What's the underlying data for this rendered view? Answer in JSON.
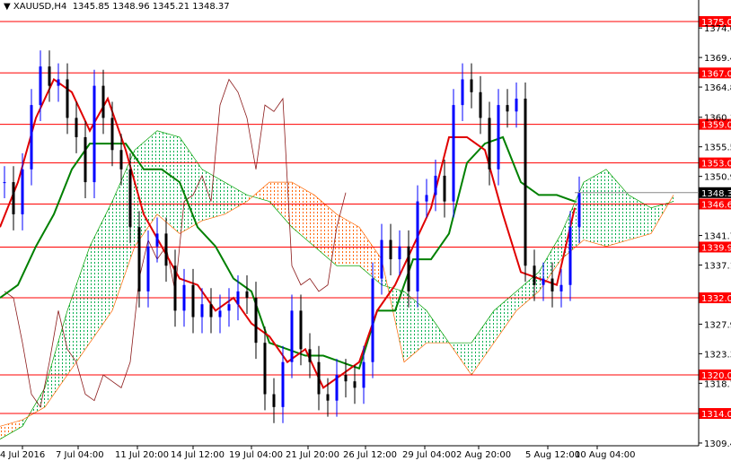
{
  "header": {
    "symbol": "XAUUSD,H4",
    "ohlc": "1345.85 1348.96 1345.21 1348.37"
  },
  "colors": {
    "level": "#ff0000",
    "tenkan": "#e00000",
    "kijun": "#008000",
    "chikou": "#8b1a1a",
    "bull": "#0000ff",
    "bear": "#000000",
    "cloud_up": "#00b050",
    "cloud_down": "#ff6600"
  },
  "chart_data": {
    "type": "line",
    "title": "XAUUSD,H4",
    "ylim": [
      1307,
      1378
    ],
    "y_ticks": [
      "1374.00",
      "1369.40",
      "1364.80",
      "1360.10",
      "1355.50",
      "1350.90",
      "1341.70",
      "1337.10",
      "1327.90",
      "1323.30",
      "1318.70",
      "1309.40"
    ],
    "x_ticks": [
      "4 Jul 2016",
      "7 Jul 04:00",
      "11 Jul 20:00",
      "14 Jul 12:00",
      "19 Jul 04:00",
      "21 Jul 20:00",
      "26 Jul 12:00",
      "29 Jul 04:00",
      "2 Aug 20:00",
      "5 Aug 12:00",
      "10 Aug 04:00"
    ],
    "levels": [
      "1375.00",
      "1367.00",
      "1359.00",
      "1353.00",
      "1346.60",
      "1339.90",
      "1332.00",
      "1320.00",
      "1314.00"
    ],
    "current_price": "1348.37",
    "close": [
      1350,
      1345,
      1352,
      1362,
      1368,
      1365,
      1366,
      1360,
      1357,
      1350,
      1365,
      1360,
      1355,
      1352,
      1343,
      1333,
      1340,
      1342,
      1337,
      1330,
      1334,
      1329,
      1331,
      1329,
      1330,
      1331,
      1333,
      1332,
      1325,
      1317,
      1315,
      1322,
      1330,
      1324,
      1322,
      1317,
      1316,
      1320,
      1319,
      1318,
      1322,
      1335,
      1341,
      1338,
      1340,
      1333,
      1347,
      1348,
      1351,
      1347,
      1362,
      1366,
      1364,
      1360,
      1352,
      1362,
      1361,
      1363,
      1337,
      1334,
      1335,
      1333,
      1334,
      1343,
      1348.37
    ],
    "tenkan": [
      1343,
      1350,
      1360,
      1366,
      1364,
      1358,
      1363,
      1355,
      1345,
      1340,
      1335,
      1334,
      1330,
      1332,
      1328,
      1326,
      1322,
      1324,
      1318,
      1320,
      1322,
      1330,
      1334,
      1340,
      1346,
      1357,
      1357,
      1355,
      1345,
      1336,
      1335,
      1334,
      1346
    ],
    "kijun": [
      1332,
      1334,
      1340,
      1345,
      1352,
      1356,
      1356,
      1356,
      1352,
      1352,
      1350,
      1343,
      1340,
      1335,
      1333,
      1325,
      1324,
      1323,
      1323,
      1322,
      1321,
      1330,
      1330,
      1338,
      1338,
      1342,
      1353,
      1356,
      1357,
      1350,
      1348,
      1348,
      1347
    ],
    "span_a": [
      1310,
      1312,
      1318,
      1330,
      1340,
      1347,
      1355,
      1358,
      1357,
      1352,
      1350,
      1348,
      1347,
      1343,
      1340,
      1337,
      1337,
      1334,
      1333,
      1330,
      1325,
      1325,
      1330,
      1333,
      1336,
      1342,
      1350,
      1352,
      1348,
      1346,
      1347
    ],
    "span_b": [
      1312,
      1313,
      1315,
      1320,
      1325,
      1330,
      1340,
      1345,
      1342,
      1344,
      1345,
      1347,
      1350,
      1350,
      1348,
      1345,
      1343,
      1338,
      1322,
      1325,
      1325,
      1320,
      1325,
      1330,
      1333,
      1338,
      1341,
      1340,
      1341,
      1342,
      1348
    ]
  }
}
